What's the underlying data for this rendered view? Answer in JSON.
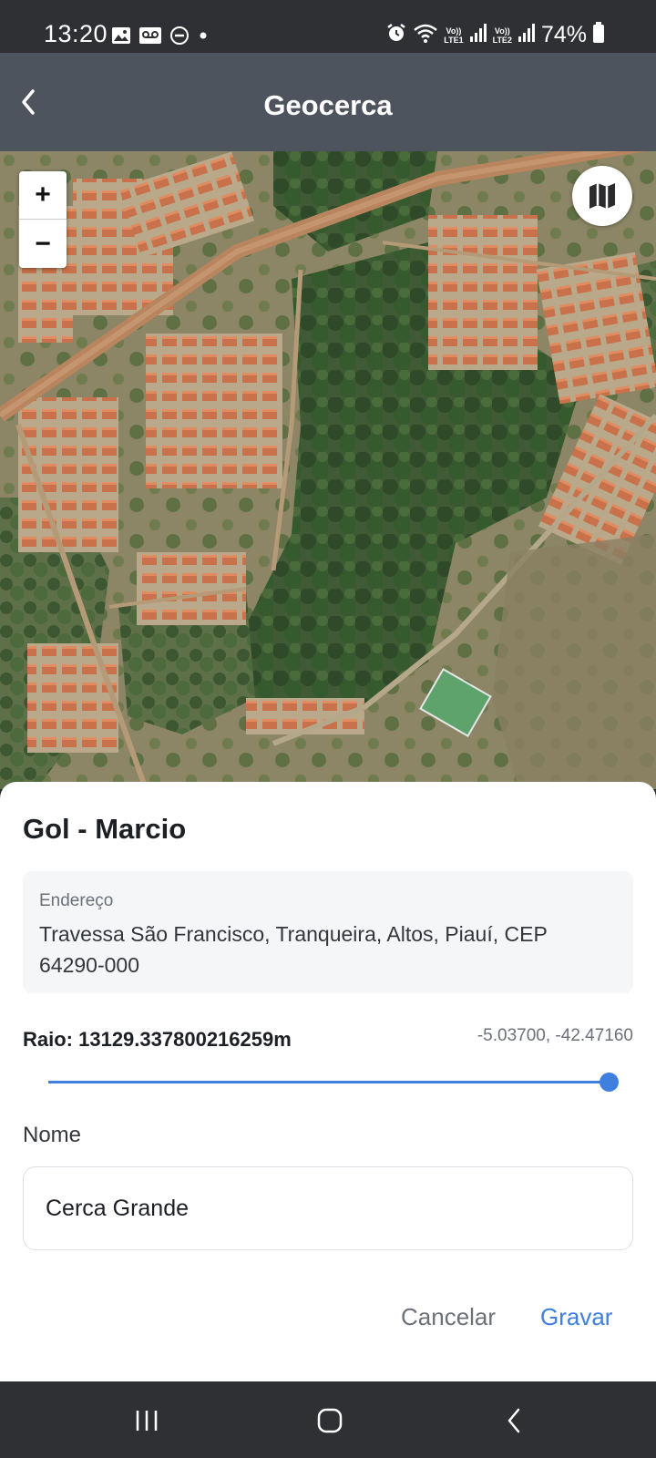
{
  "status_bar": {
    "time": "13:20",
    "battery": "74%",
    "lte1": "LTE1",
    "lte2": "LTE2",
    "volte": "Vo))"
  },
  "app_bar": {
    "title": "Geocerca",
    "back_icon": "chevron-left-icon"
  },
  "map": {
    "zoom_in_label": "+",
    "zoom_out_label": "−",
    "map_type_icon": "map-layers-icon"
  },
  "sheet": {
    "title": "Gol - Marcio",
    "address_label": "Endereço",
    "address_value": "Travessa São Francisco, Tranqueira, Altos, Piauí, CEP 64290-000",
    "radius_text": "Raio: 13129.337800216259m",
    "coordinates": "-5.03700, -42.47160",
    "slider_fraction": 1.0,
    "name_label": "Nome",
    "name_value": "Cerca Grande",
    "cancel_label": "Cancelar",
    "save_label": "Gravar",
    "accent_color": "#3f7fe0"
  },
  "nav_bar": {
    "recents_icon": "recents-icon",
    "home_icon": "home-icon",
    "back_icon": "back-icon"
  }
}
